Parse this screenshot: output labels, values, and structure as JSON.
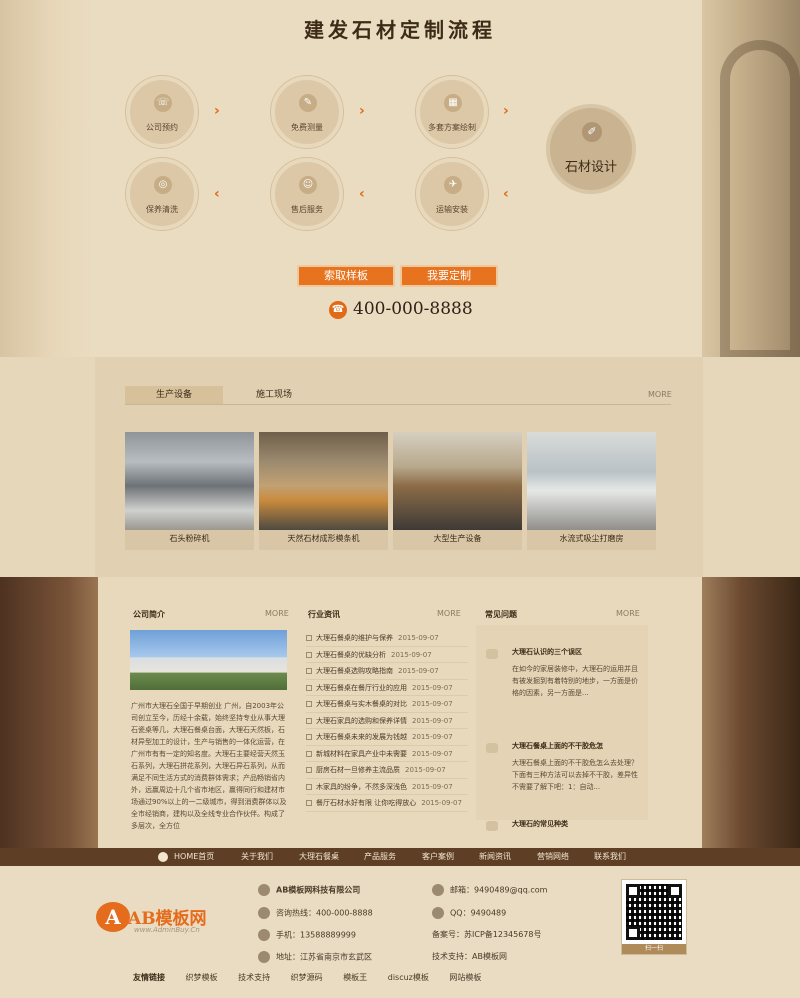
{
  "process": {
    "title": "建发石材定制流程",
    "steps": [
      {
        "label": "公司预约",
        "icon": "phone-icon"
      },
      {
        "label": "免费测量",
        "icon": "ruler-icon"
      },
      {
        "label": "多套方案绘制",
        "icon": "chart-icon"
      },
      {
        "label": "石材设计",
        "icon": "pen-icon"
      },
      {
        "label": "保养清洗",
        "icon": "clean-icon"
      },
      {
        "label": "售后服务",
        "icon": "service-icon"
      },
      {
        "label": "运输安装",
        "icon": "truck-icon"
      }
    ],
    "arrow": "›",
    "arrow_back": "‹",
    "btn_sample": "索取样板",
    "btn_custom": "我要定制",
    "phone": "400-000-8888"
  },
  "equip": {
    "tabs": [
      "生产设备",
      "施工现场"
    ],
    "more": "MORE",
    "items": [
      "石头粉碎机",
      "天然石材成形模条机",
      "大型生产设备",
      "水流式吸尘打磨房"
    ]
  },
  "about": {
    "title": "公司简介",
    "more": "MORE",
    "text": "广州市大理石全国于早期创业 广州，自2003年公司创立至今，历经十余载，始终坚持专业从事大理石瓷桌等几，大理石餐桌台面，大理石天然板，石材异型加工的设计，生产与销售的一体化运营，在广州市有有一定的知名度。大理石主要经营天然玉石系列，大理石拼花系列，大理石异石系列，从而满足不同生活方式的消费群体需求；产品畅销省内外，远赢周边十几个省市地区，赢得同行和建材市场通过90%以上的一二级城市，得到消费群体以及全市经销商，建构以及全线专业合作伙伴。构成了多层次，全方位"
  },
  "news": {
    "title": "行业资讯",
    "more": "MORE",
    "items": [
      {
        "t": "大理石餐桌的维护与保养",
        "d": "2015-09-07"
      },
      {
        "t": "大理石餐桌的优缺分析",
        "d": "2015-09-07"
      },
      {
        "t": "大理石餐桌选购攻略指南",
        "d": "2015-09-07"
      },
      {
        "t": "大理石餐桌在餐厅行业的应用",
        "d": "2015-09-07"
      },
      {
        "t": "大理石餐桌与实木餐桌的对比",
        "d": "2015-09-07"
      },
      {
        "t": "大理石家具的选购和保养详情",
        "d": "2015-09-07"
      },
      {
        "t": "大理石餐桌未来的发展为钱越",
        "d": "2015-09-07"
      },
      {
        "t": "新城材料在家具产业中未需要",
        "d": "2015-09-07"
      },
      {
        "t": "厨房石材一旦修养主流品质",
        "d": "2015-09-07"
      },
      {
        "t": "木家具的纷争，不然多深浅色",
        "d": "2015-09-07"
      },
      {
        "t": "餐厅石材水好有限 让你吃得放心",
        "d": "2015-09-07"
      }
    ]
  },
  "faq": {
    "title": "常见问题",
    "more": "MORE",
    "items": [
      {
        "q": "大理石认识的三个误区",
        "a": "在如今的家居装修中，大理石的运用并且有被发掘到有着特别的地步，一方面是价格的因素，另一方面是..."
      },
      {
        "q": "大理石餐桌上面的不干胶危怎",
        "a": "大理石餐桌上面的不干胶危怎么去处理？下面有三种方法可以去掉不干胶，差异性不需要了解下吧：1：自动..."
      },
      {
        "q": "大理石的常见种类",
        "a": ""
      }
    ]
  },
  "nav": [
    "HOME首页",
    "关于我们",
    "大理石餐桌",
    "产品服务",
    "客户案例",
    "新闻资讯",
    "营销网络",
    "联系我们"
  ],
  "footer": {
    "logo_text": "AB模板网",
    "logo_letter": "A",
    "logo_url": "www.AdminBuy.Cn",
    "company": "AB模板网科技有限公司",
    "hotline": "咨询热线：400-000-8888",
    "mobile": "手机：13588889999",
    "address": "地址：江苏省南京市玄武区",
    "email": "邮箱：9490489@qq.com",
    "qq": "QQ：9490489",
    "icp": "备案号：苏ICP备12345678号",
    "support": "技术支持：AB模板网",
    "qr_caption": "扫一扫",
    "links_title": "友情链接",
    "links": [
      "织梦模板",
      "技术支持",
      "织梦源码",
      "模板王",
      "discuz模板",
      "网站模板"
    ]
  }
}
